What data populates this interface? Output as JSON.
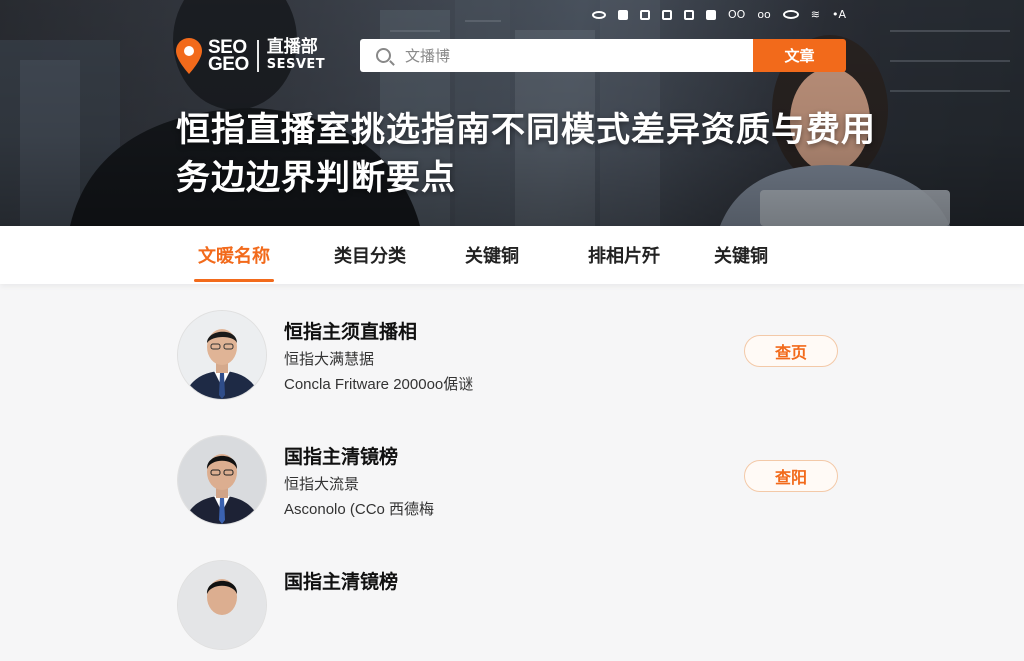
{
  "status_bar": {
    "signal_text": "•A",
    "indicator_text": "OO"
  },
  "logo": {
    "line1": "SEO",
    "line2": "GEO",
    "cn": "直播部",
    "en": "SESVET"
  },
  "search": {
    "placeholder": "文播博",
    "button_label": "文章"
  },
  "hero": {
    "title": "恒指直播室挑选指南不同模式差异资质与费用务边边界判断要点"
  },
  "tabs": [
    {
      "label": "文暖名称",
      "active": true
    },
    {
      "label": "类目分类",
      "active": false
    },
    {
      "label": "关键铜",
      "active": false
    },
    {
      "label": "排相片歼",
      "active": false
    },
    {
      "label": "关键铜",
      "active": false
    }
  ],
  "items": [
    {
      "title": "恒指主须直播相",
      "subtitle": "恒指大满慧据",
      "meta": "Concla Fritware 2000oo倨谜",
      "button": "查页"
    },
    {
      "title": "国指主清镜榜",
      "subtitle": "恒指大流景",
      "meta": "Asconolo (CCo 西德梅",
      "button": "查阳"
    },
    {
      "title": "国指主清镜榜"
    }
  ],
  "colors": {
    "accent": "#f26a1b",
    "hero_bg": "#2f333a",
    "tab_bg": "#ffffff",
    "page_bg": "#f6f6f7"
  }
}
